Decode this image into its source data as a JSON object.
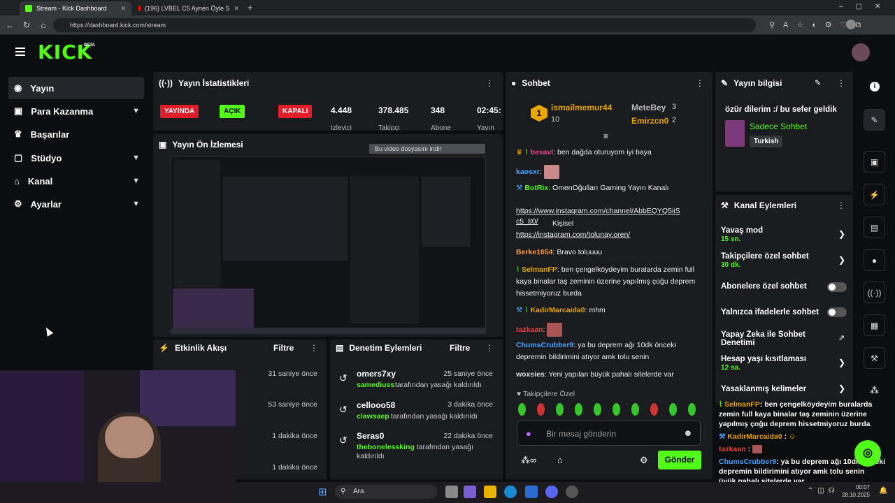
{
  "browser": {
    "tab1_title": "Stream - Kick Dashboard",
    "tab2_title": "(196) LVBEL C5 Aynen Öyle S",
    "url": "https://dashboard.kick.com/stream"
  },
  "brand": {
    "logo": "KICK",
    "beta": "BETA"
  },
  "sidebar": {
    "items": [
      {
        "label": "Yayın"
      },
      {
        "label": "Para Kazanma"
      },
      {
        "label": "Başarılar"
      },
      {
        "label": "Stüdyo"
      },
      {
        "label": "Kanal"
      },
      {
        "label": "Ayarlar"
      }
    ]
  },
  "stats": {
    "title": "Yayın İstatistikleri",
    "badge_live": "YAYINDA",
    "badge_open": "AÇIK",
    "badge_closed": "KAPALI",
    "viewers": "4.448",
    "viewers_label": "İzleyici",
    "followers": "378.485",
    "followers_label": "Takipçi",
    "subs": "348",
    "subs_label": "Abone",
    "duration": "02:45:",
    "duration_label": "Yayın"
  },
  "preview": {
    "title": "Yayın Ön İzlemesi",
    "download": "Bu video dosyasını indir"
  },
  "activity": {
    "title": "Etkinlik Akışı",
    "filter": "Filtre",
    "times": [
      "31 saniye önce",
      "53 saniye önce",
      "1 dakika önce",
      "1 dakika önce"
    ]
  },
  "moderation": {
    "title": "Denetim Eylemleri",
    "filter": "Filtre",
    "rows": [
      {
        "user": "omers7xy",
        "time": "25 saniye önce",
        "by": "samediuss",
        "action": "tarafından yasağı kaldırıldı"
      },
      {
        "user": "cellooo58",
        "time": "3 dakika önce",
        "by": "clawsaep",
        "action": "tarafından yasağı kaldırıldı"
      },
      {
        "user": "Seras0",
        "time": "22 dakika önce",
        "by": "thebonelessking",
        "action": "tarafından yasağı kaldırıldı"
      }
    ]
  },
  "chat": {
    "title": "Sohbet",
    "top1_name": "ismailmemur44",
    "top1_count": "10",
    "top2_name": "MeteBey",
    "top2_count": "3",
    "top3_name": "Emirzcn0",
    "top3_count": "2",
    "messages": [
      {
        "user": "besavl",
        "text": "ben dağda oturuyom iyi baya"
      },
      {
        "user": "kaosxr",
        "text": ""
      },
      {
        "user": "BotRix",
        "text": "OmenOğulları Gaming Yayın Kanalı"
      },
      {
        "user": "",
        "text": "https://www.instagram.com/channel/AbbEQYQ5iiS c5_80/"
      },
      {
        "user": "",
        "text": "Kişisel"
      },
      {
        "user": "",
        "text": "https://instagram.com/tolunay.oren/"
      },
      {
        "user": "Berke1654",
        "text": "Bravo toluuuu"
      },
      {
        "user": "SelmanFP",
        "text": "ben çengelköydeyim buralarda zemin full kaya binalar taş zeminin üzerine yapılmış çoğu deprem hissetmiyoruz burda"
      },
      {
        "user": "KadirMarcaida0",
        "text": "mhm"
      },
      {
        "user": "tazkaan",
        "text": ""
      },
      {
        "user": "ChumsCrubber9",
        "text": "ya bu deprem ağı 10dk önceki depremin bildirimini atıyor amk tolu senin"
      },
      {
        "user": "woxsies",
        "text": "Yeni yapılan büyük pahalı sitelerde var"
      }
    ],
    "followers_only": "Takipçilere Özel",
    "input_placeholder": "Bir mesaj gönderin",
    "send": "Gönder"
  },
  "stream_info": {
    "title": "Yayın bilgisi",
    "stream_title": "özür dilerim :/ bu sefer geldik",
    "category": "Sadece Sohbet",
    "language": "Turkish"
  },
  "channel_actions": {
    "title": "Kanal Eylemleri",
    "slow_mode": "Yavaş mod",
    "slow_value": "15 sn.",
    "followers_chat": "Takipçilere özel sohbet",
    "followers_value": "30 dk.",
    "subs_chat": "Abonelere özel sohbet",
    "emote_chat": "Yalnızca ifadelerle sohbet",
    "ai_chat": "Yapay Zeka ile Sohbet Denetimi",
    "age_limit": "Hesap yaşı kısıtlaması",
    "age_value": "12 sa.",
    "banned_words": "Yasaklanmış kelimeler"
  },
  "overlay": {
    "line1_user": "SelmanFP",
    "line1_text": ": ben çengelköydeyim buralarda zemin full kaya binalar taş zeminin üzerine yapılmış çoğu deprem hissetmiyoruz burda",
    "line2_user": "KadirMarcaida0",
    "line3_user": "tazkaan",
    "line4_user": "ChumsCrubber9",
    "line4_text": ": ya bu deprem ağı 10dk önceki depremin bildirimini atıyor amk tolu senin",
    "line5_text": "üyük pahalı sitelerde var"
  },
  "taskbar": {
    "search": "Ara",
    "time": "00:07",
    "date": "28.10.2025"
  },
  "colors": {
    "accent": "#53fc18",
    "live_red": "#e11d2a",
    "bg": "#0b0d0f",
    "panel": "#191b1f"
  }
}
